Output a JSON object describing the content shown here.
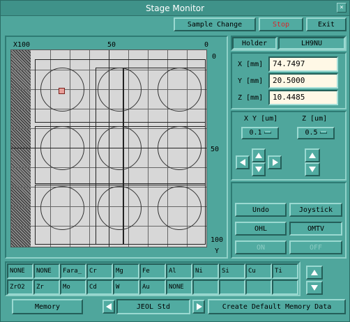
{
  "window": {
    "title": "Stage Monitor"
  },
  "toolbar": {
    "sample_change": "Sample Change",
    "stop": "Stop",
    "exit": "Exit"
  },
  "stage": {
    "top_left_label": "X100",
    "top_mid_label": "50",
    "top_right_label": "0",
    "right_top_label": "0",
    "right_mid_label": "50",
    "right_bottom_label": "100",
    "right_axis_label": "Y"
  },
  "holder": {
    "label": "Holder",
    "value": "LH9NU"
  },
  "coords": {
    "x_label": "X [mm]",
    "x_value": "74.7497",
    "y_label": "Y [mm]",
    "y_value": "20.5000",
    "z_label": "Z [mm]",
    "z_value": "10.4485"
  },
  "steps": {
    "xy_label": "X Y [um]",
    "xy_value": "0.1",
    "z_label": "Z [um]",
    "z_value": "0.5"
  },
  "controls": {
    "undo": "Undo",
    "joystick": "Joystick",
    "ohl": "OHL",
    "omtv": "OMTV",
    "on": "ON",
    "off": "OFF"
  },
  "materials": {
    "row1": [
      "NONE",
      "NONE",
      "Fara_",
      "Cr",
      "Mg",
      "Fe",
      "Al",
      "Ni",
      "Si",
      "Cu",
      "Ti"
    ],
    "row2": [
      "ZrO2",
      "Zr",
      "Mo",
      "Cd",
      "W",
      "Au",
      "NONE",
      "",
      "",
      "",
      ""
    ]
  },
  "bottom": {
    "memory": "Memory",
    "preset": "JEOL Std",
    "create_default": "Create Default Memory Data"
  },
  "colors": {
    "accent": "#4fa69c",
    "stop_text": "#d8262b",
    "field_bg": "#fff8e6"
  }
}
